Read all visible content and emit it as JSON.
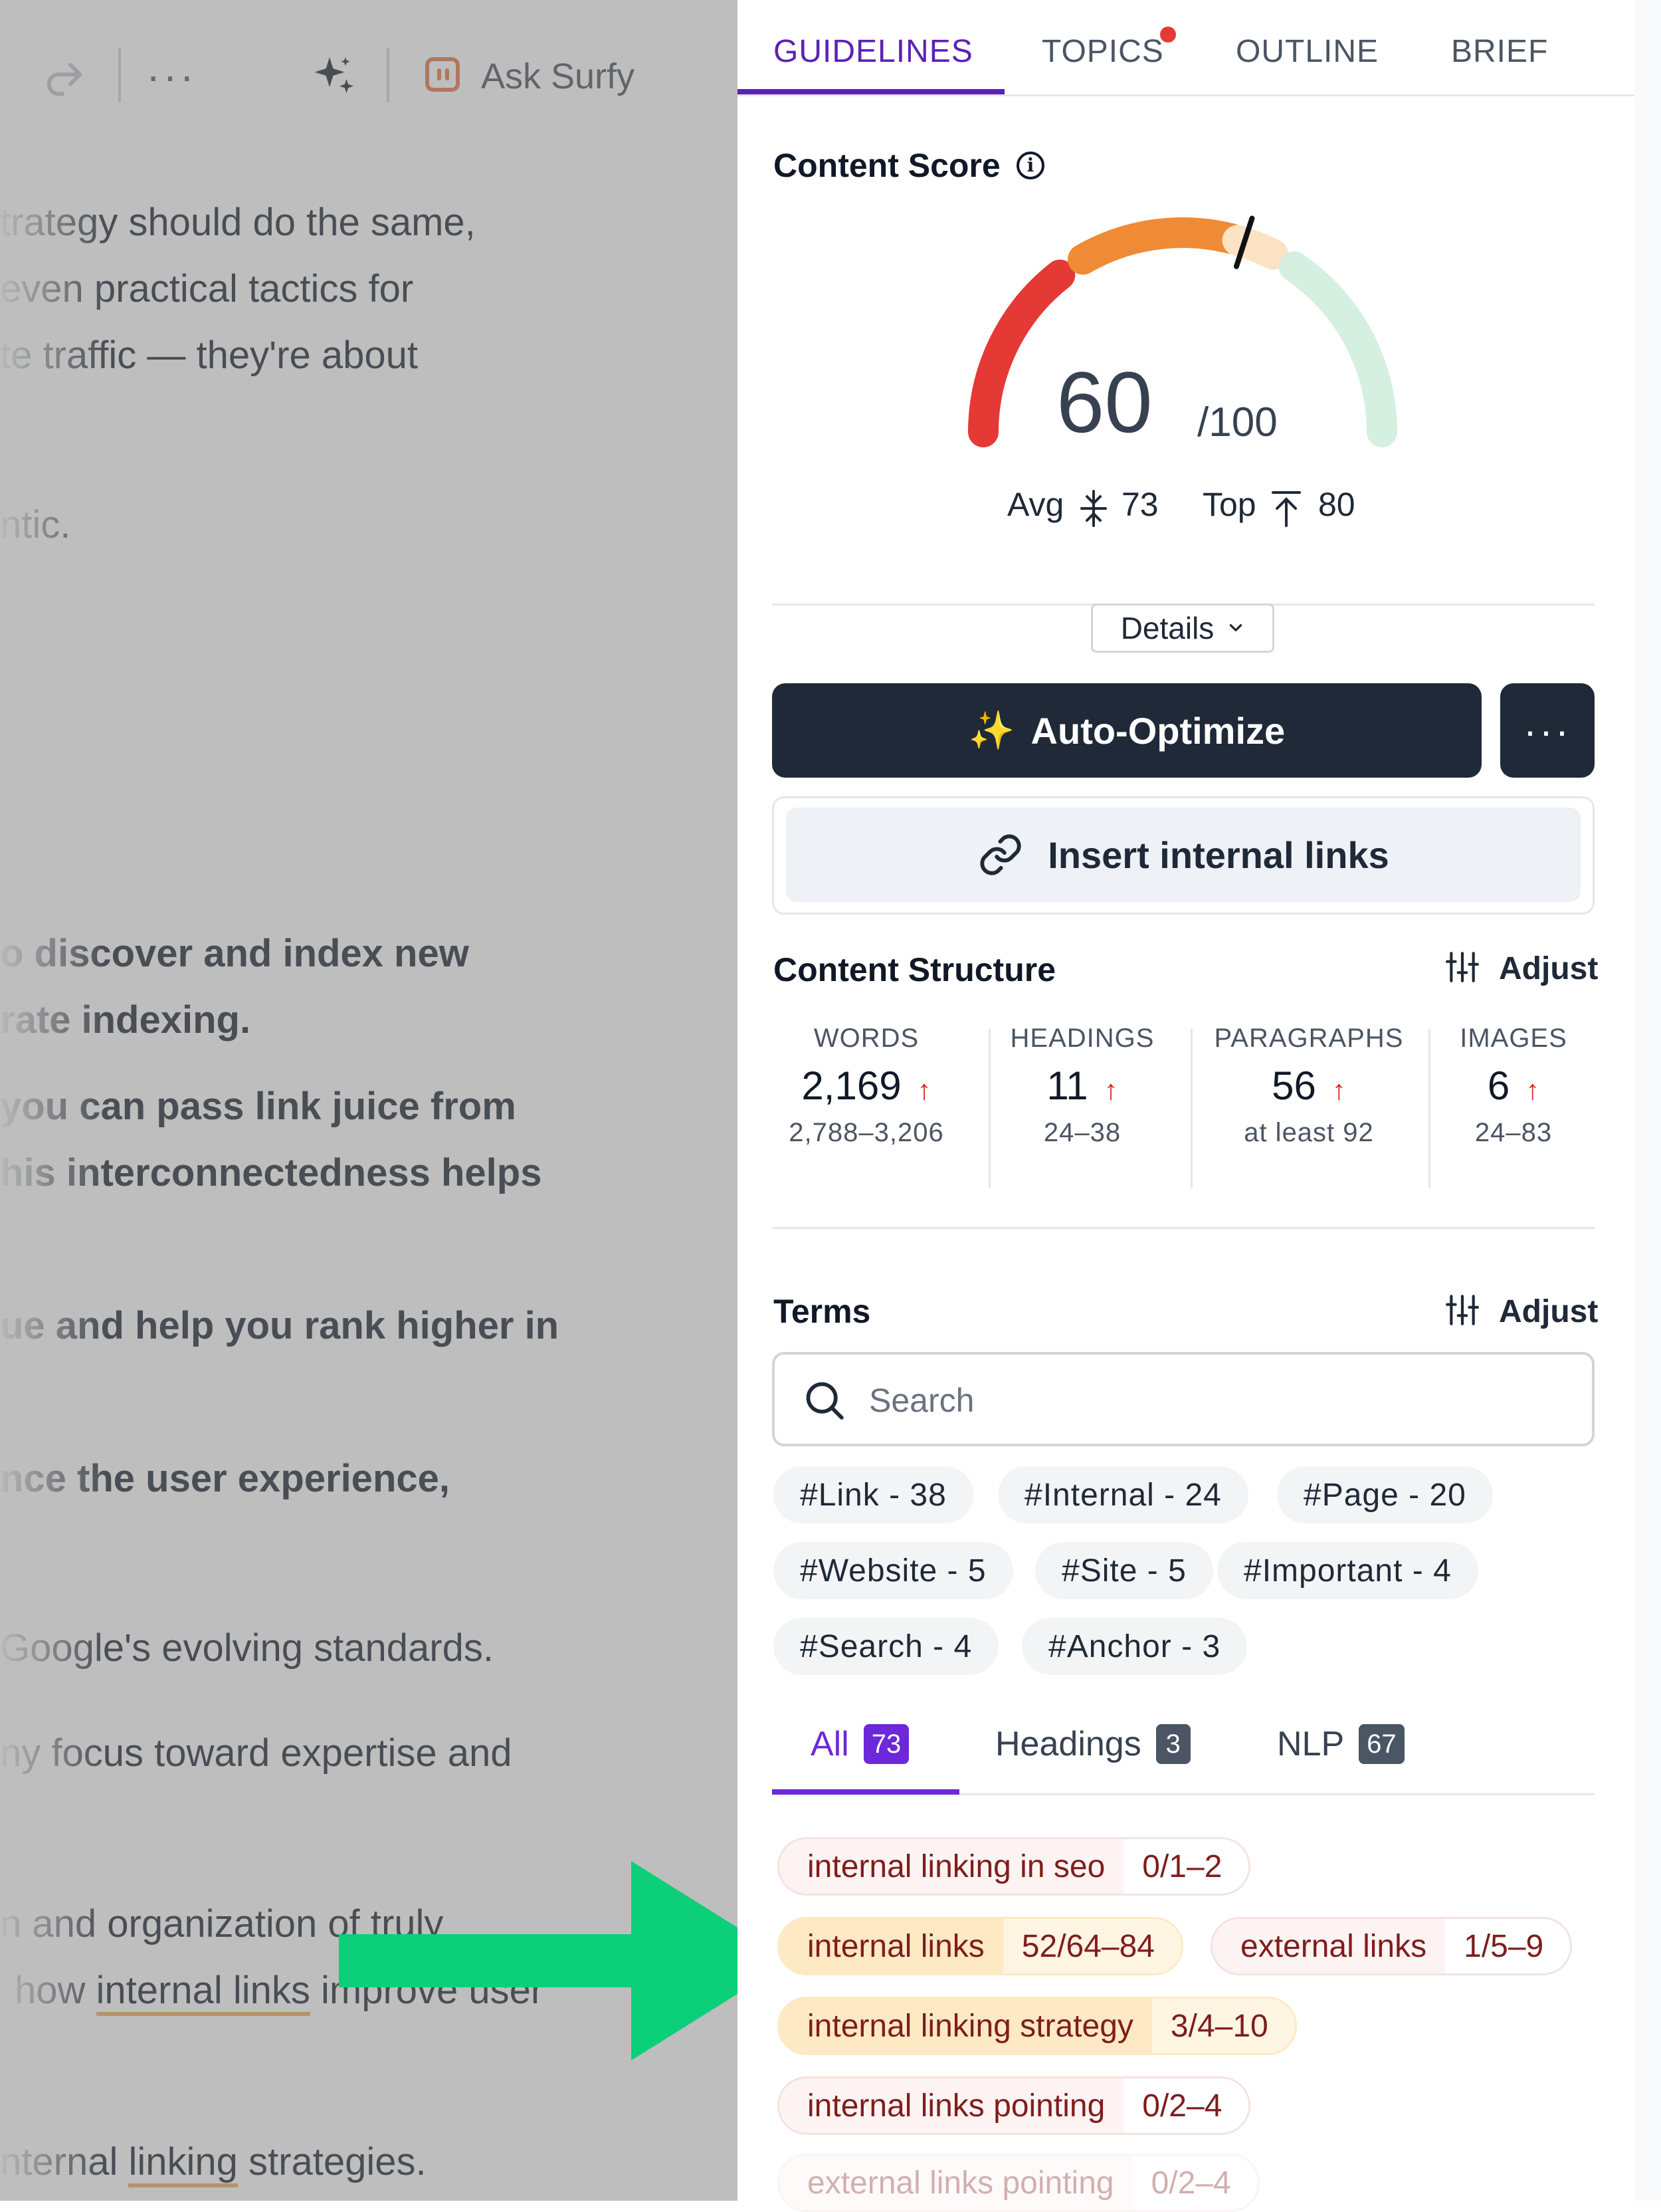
{
  "editor": {
    "toolbar": {
      "more_label": "···",
      "ask_label": "Ask Surfy",
      "icons": [
        "redo-icon",
        "more-icon",
        "sparkle-icon",
        "surfy-icon"
      ]
    },
    "lines": [
      {
        "text": "trategy should do the same,",
        "bold": false
      },
      {
        "text": "even practical tactics for",
        "bold": false
      },
      {
        "text": "te traffic — they're about",
        "bold": false
      },
      {
        "text": "ntic.",
        "bold": false
      },
      {
        "text": "o discover and index new",
        "bold": true
      },
      {
        "text": "rate indexing.",
        "bold": true
      },
      {
        "text": "you can pass link juice from",
        "bold": true
      },
      {
        "text": "his interconnectedness helps",
        "bold": true
      },
      {
        "text": "ue and help you rank higher in",
        "bold": true
      },
      {
        "text": "nce the user experience,",
        "bold": true
      },
      {
        "text": "Google's evolving standards.",
        "bold": false
      },
      {
        "text": "ny focus toward expertise and",
        "bold": false
      },
      {
        "text": "n and organization of truly",
        "bold": false
      },
      {
        "pre": "how ",
        "underlined": "internal links",
        "post": " improve user",
        "bold": false
      },
      {
        "pre": "nternal ",
        "underlined": "linking",
        "post": " strategies.",
        "bold": false
      }
    ]
  },
  "panel": {
    "tabs": [
      {
        "label": "GUIDELINES",
        "active": true
      },
      {
        "label": "TOPICS",
        "active": false,
        "notification": true
      },
      {
        "label": "OUTLINE",
        "active": false
      },
      {
        "label": "BRIEF",
        "active": false
      }
    ],
    "content_score": {
      "title": "Content Score",
      "score": "60",
      "out_of": "/100",
      "score_fraction": 0.6,
      "avg_label": "Avg",
      "avg_value": "73",
      "top_label": "Top",
      "top_value": "80",
      "gauge_colors": [
        "#e53935",
        "#ef8a35",
        "#fbe3c4",
        "#d5f0e0"
      ]
    },
    "details_label": "Details",
    "auto_optimize": {
      "emoji": "✨",
      "label": "Auto-Optimize",
      "more_label": "···"
    },
    "insert_links_label": "Insert internal links",
    "content_structure": {
      "title": "Content Structure",
      "adjust_label": "Adjust",
      "stats": [
        {
          "label": "WORDS",
          "value": "2,169",
          "arrow": "↑",
          "range": "2,788–3,206"
        },
        {
          "label": "HEADINGS",
          "value": "11",
          "arrow": "↑",
          "range": "24–38"
        },
        {
          "label": "PARAGRAPHS",
          "value": "56",
          "arrow": "↑",
          "range": "at least 92"
        },
        {
          "label": "IMAGES",
          "value": "6",
          "arrow": "↑",
          "range": "24–83"
        }
      ]
    },
    "terms": {
      "title": "Terms",
      "adjust_label": "Adjust",
      "search_placeholder": "Search",
      "chips": [
        "#Link - 38",
        "#Internal - 24",
        "#Page - 20",
        "#Website - 5",
        "#Site - 5",
        "#Important - 4",
        "#Search - 4",
        "#Anchor - 3"
      ],
      "sub_tabs": [
        {
          "label": "All",
          "count": "73",
          "active": true
        },
        {
          "label": "Headings",
          "count": "3",
          "active": false
        },
        {
          "label": "NLP",
          "count": "67",
          "active": false
        }
      ],
      "items": [
        {
          "name": "internal linking in seo",
          "count": "0/1–2",
          "style": "red"
        },
        {
          "name": "internal links",
          "count": "52/64–84",
          "style": "yellow"
        },
        {
          "name": "external links",
          "count": "1/5–9",
          "style": "red"
        },
        {
          "name": "internal linking strategy",
          "count": "3/4–10",
          "style": "yellow"
        },
        {
          "name": "internal links pointing",
          "count": "0/2–4",
          "style": "red"
        },
        {
          "name": "external links pointing",
          "count": "0/2–4",
          "style": "faded"
        }
      ]
    },
    "accent_color": "#5b21b6"
  }
}
